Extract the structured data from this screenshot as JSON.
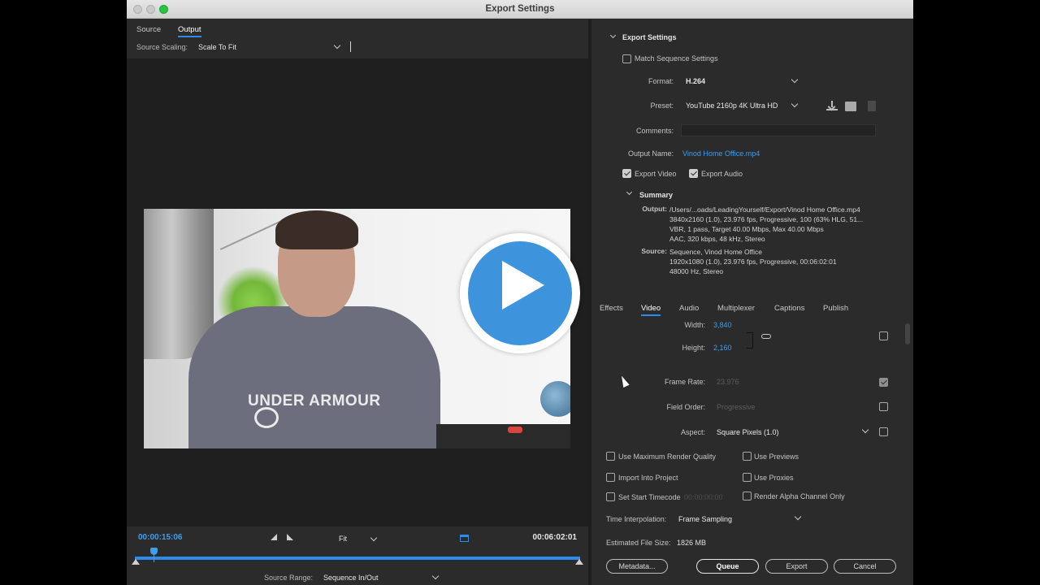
{
  "window": {
    "title": "Export Settings"
  },
  "left": {
    "tabs": [
      {
        "label": "Source"
      },
      {
        "label": "Output"
      }
    ],
    "source_scaling": {
      "label": "Source Scaling:",
      "value": "Scale To Fit"
    },
    "video_logo_text": "UNDER ARMOUR",
    "timeline": {
      "current": "00:00:15:06",
      "duration": "00:06:02:01",
      "fit": "Fit",
      "progress_fraction": 0.042,
      "source_range": {
        "label": "Source Range:",
        "value": "Sequence In/Out"
      }
    }
  },
  "export_settings": {
    "title": "Export Settings",
    "match_sequence": "Match Sequence Settings",
    "format": {
      "label": "Format:",
      "value": "H.264"
    },
    "preset": {
      "label": "Preset:",
      "value": "YouTube 2160p 4K Ultra HD"
    },
    "comments": {
      "label": "Comments:",
      "value": ""
    },
    "output_name": {
      "label": "Output Name:",
      "value": "Vinod Home Office.mp4"
    },
    "export_video": {
      "label": "Export Video",
      "checked": true
    },
    "export_audio": {
      "label": "Export Audio",
      "checked": true
    }
  },
  "summary": {
    "title": "Summary",
    "output_key": "Output:",
    "output_lines": [
      "/Users/...oads/LeadingYourself/Export/Vinod Home Office.mp4",
      "3840x2160 (1.0), 23.976 fps, Progressive, 100 (63% HLG, 51...",
      "VBR, 1 pass, Target 40.00 Mbps, Max 40.00 Mbps",
      "AAC, 320 kbps, 48 kHz, Stereo"
    ],
    "source_key": "Source:",
    "source_lines": [
      "Sequence, Vinod Home Office",
      "1920x1080 (1.0), 23.976 fps, Progressive, 00:06:02:01",
      "48000 Hz, Stereo"
    ]
  },
  "tabs": [
    {
      "label": "Effects"
    },
    {
      "label": "Video"
    },
    {
      "label": "Audio"
    },
    {
      "label": "Multiplexer"
    },
    {
      "label": "Captions"
    },
    {
      "label": "Publish"
    }
  ],
  "video": {
    "width": {
      "label": "Width:",
      "value": "3,840"
    },
    "height": {
      "label": "Height:",
      "value": "2,160"
    },
    "frame_rate": {
      "label": "Frame Rate:",
      "value": "23.976"
    },
    "field_order": {
      "label": "Field Order:",
      "value": "Progressive"
    },
    "aspect": {
      "label": "Aspect:",
      "value": "Square Pixels (1.0)"
    }
  },
  "options": {
    "max_render_quality": "Use Maximum Render Quality",
    "use_previews": "Use Previews",
    "import_into_project": "Import Into Project",
    "use_proxies": "Use Proxies",
    "set_start_timecode": "Set Start Timecode",
    "start_timecode_value": "00:00:00:00",
    "render_alpha": "Render Alpha Channel Only",
    "time_interpolation": {
      "label": "Time Interpolation:",
      "value": "Frame Sampling"
    },
    "estimated_size": {
      "label": "Estimated File Size:",
      "value": "1826 MB"
    }
  },
  "buttons": {
    "metadata": "Metadata...",
    "queue": "Queue",
    "export": "Export",
    "cancel": "Cancel"
  },
  "colors": {
    "accent": "#2d8ceb",
    "link": "#3c9ef0",
    "panel": "#2b2b2b",
    "play": "#3d93dc"
  }
}
